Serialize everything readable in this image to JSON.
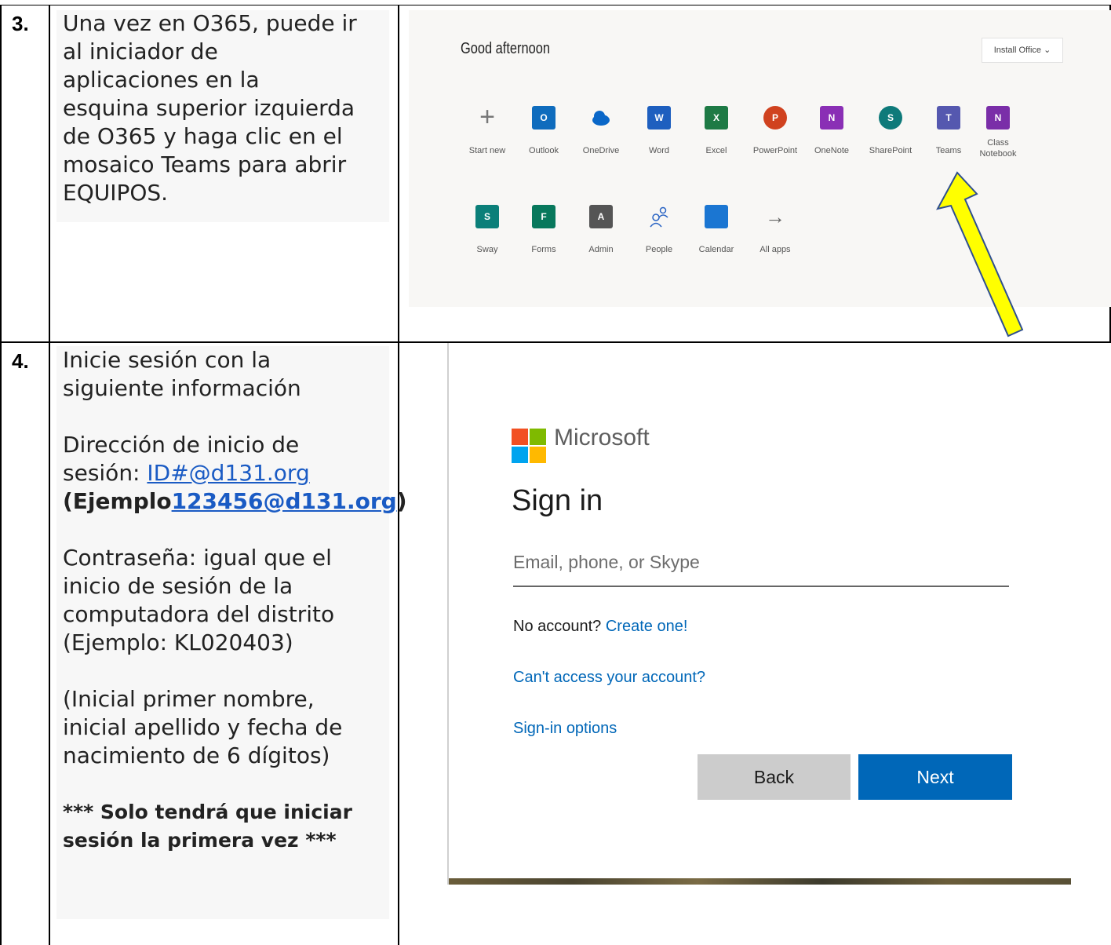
{
  "step3": {
    "number": "3.",
    "lines": [
      "Una vez en O365, puede ir",
      "al iniciador de",
      "aplicaciones en la",
      "esquina superior izquierda",
      "de O365 y haga clic en el",
      "mosaico Teams para abrir",
      "EQUIPOS."
    ]
  },
  "o365": {
    "greeting": "Good afternoon",
    "install_label": "Install Office",
    "apps_row1": [
      {
        "label": "Start new",
        "icon": "plus-icon",
        "color": ""
      },
      {
        "label": "Outlook",
        "icon": "outlook-icon",
        "color": "#0f6cbd"
      },
      {
        "label": "OneDrive",
        "icon": "onedrive-icon",
        "color": "#0a67c8"
      },
      {
        "label": "Word",
        "icon": "word-icon",
        "color": "#1e5fbf"
      },
      {
        "label": "Excel",
        "icon": "excel-icon",
        "color": "#1e7a45"
      },
      {
        "label": "PowerPoint",
        "icon": "powerpoint-icon",
        "color": "#d0421f"
      },
      {
        "label": "OneNote",
        "icon": "onenote-icon",
        "color": "#8a2fb5"
      },
      {
        "label": "SharePoint",
        "icon": "sharepoint-icon",
        "color": "#0e7a7a"
      },
      {
        "label": "Teams",
        "icon": "teams-icon",
        "color": "#5558af"
      },
      {
        "label": "Class Notebook",
        "icon": "class-notebook-icon",
        "color": "#7a2ea8"
      }
    ],
    "apps_row2": [
      {
        "label": "Sway",
        "icon": "sway-icon",
        "color": "#0b7f79"
      },
      {
        "label": "Forms",
        "icon": "forms-icon",
        "color": "#08785c"
      },
      {
        "label": "Admin",
        "icon": "admin-icon",
        "color": "#555555"
      },
      {
        "label": "People",
        "icon": "people-icon",
        "color": "#2a64c4"
      },
      {
        "label": "Calendar",
        "icon": "calendar-icon",
        "color": "#1b76d2"
      },
      {
        "label": "All apps",
        "icon": "arrow-right-icon",
        "color": ""
      }
    ]
  },
  "step4": {
    "number": "4.",
    "intro": [
      "Inicie sesión con la",
      "siguiente información"
    ],
    "address_line1": "Dirección de inicio de",
    "address_prefix": "sesión: ",
    "address_link": "ID#@d131.org",
    "example_open": "(Ejemplo",
    "example_link": "123456@d131.org",
    "example_close": ")",
    "password_lines": [
      "Contraseña: igual que el",
      "inicio de sesión de la",
      "computadora del distrito",
      "(Ejemplo: KL020403)"
    ],
    "note_lines": [
      "(Inicial primer nombre,",
      "inicial apellido y fecha de",
      "nacimiento de 6 dígitos)"
    ],
    "warning_lines": [
      "*** Solo tendrá que iniciar",
      "sesión la primera vez ***"
    ]
  },
  "signin": {
    "brand": "Microsoft",
    "title": "Sign in",
    "email_placeholder": "Email, phone, or Skype",
    "no_account": "No account?",
    "create_one": "Create one!",
    "cant_access": "Can't access your account?",
    "options": "Sign-in options",
    "back": "Back",
    "next": "Next",
    "logo_colors": [
      "#f25022",
      "#7fba00",
      "#00a4ef",
      "#ffb900"
    ]
  }
}
